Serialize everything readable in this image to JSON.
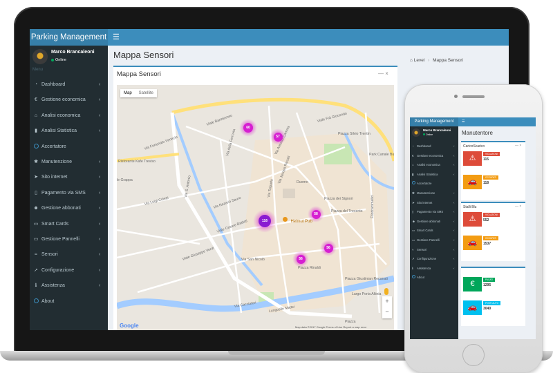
{
  "app": {
    "brand": "Parking Management"
  },
  "user": {
    "name": "Marco Brancaleoni",
    "status": "Online"
  },
  "sidebar": {
    "header": "Menu",
    "items": [
      {
        "label": "Dashboard",
        "icon": "dashboard-icon",
        "glyph": "◔",
        "chevron": "‹"
      },
      {
        "label": "Gestione economica",
        "icon": "euro-icon",
        "glyph": "€",
        "chevron": "‹"
      },
      {
        "label": "Analisi economica",
        "icon": "bank-icon",
        "glyph": "⌂",
        "chevron": "‹"
      },
      {
        "label": "Analisi Statistica",
        "icon": "bar-chart-icon",
        "glyph": "▮",
        "chevron": "‹"
      },
      {
        "label": "Accertatore",
        "icon": "circle-icon",
        "glyph": "",
        "chevron": ""
      },
      {
        "label": "Manutenzione",
        "icon": "gear-icon",
        "glyph": "✱",
        "chevron": "‹"
      },
      {
        "label": "Sito internet",
        "icon": "arrow-icon",
        "glyph": "➤",
        "chevron": "‹"
      },
      {
        "label": "Pagamento via SMS",
        "icon": "phone-icon",
        "glyph": "▯",
        "chevron": "‹"
      },
      {
        "label": "Gestione abbonati",
        "icon": "users-icon",
        "glyph": "☻",
        "chevron": "‹"
      },
      {
        "label": "Smart Cards",
        "icon": "credit-card-icon",
        "glyph": "▭",
        "chevron": "‹"
      },
      {
        "label": "Gestione Pannelli",
        "icon": "monitor-icon",
        "glyph": "▭",
        "chevron": "‹"
      },
      {
        "label": "Sensori",
        "icon": "wifi-icon",
        "glyph": "≈",
        "chevron": "‹"
      },
      {
        "label": "Configurazione",
        "icon": "rocket-icon",
        "glyph": "➚",
        "chevron": "‹"
      },
      {
        "label": "Assistenza",
        "icon": "info-icon",
        "glyph": "ℹ",
        "chevron": "‹"
      },
      {
        "label": "About",
        "icon": "circle-icon",
        "glyph": "",
        "chevron": ""
      }
    ]
  },
  "content": {
    "title": "Mappa Sensori",
    "breadcrumb": {
      "home": "Level",
      "current": "Mappa Sensori"
    }
  },
  "map_box": {
    "title": "Mappa Sensori",
    "tools": "—   ×",
    "map_type": [
      "Map",
      "Satellite"
    ],
    "zoom_in": "+",
    "zoom_out": "−",
    "logo": "Google",
    "copyright": "Map data ©2017 Google   Terms of Use   Report a map error",
    "pois": [
      "Helmut Pub"
    ],
    "streets": [
      "Viale Bartolomeo",
      "Via Fortunato Venezio",
      "Viale Frà Giocondo",
      "Piazza Silvio Trentin",
      "Park Canale Buranelli",
      "Via Antonio Canova",
      "Via Jacopo Riccati",
      "Duomo",
      "Piazza dei Signori",
      "Piazza del Trecento",
      "Via Luigi Coletti",
      "Viale Giuseppe Verdi",
      "Via San Nicolò",
      "Piazza Rinaldi",
      "Piazza Giustinian Recanati",
      "Via Cacciatori",
      "Via della Ferrovia",
      "Filodrammatici",
      "Piazza",
      "Largo Porta Altinia",
      "Lungosile Mattei",
      "Via Nazario Sauro",
      "Viale Cesare Battisti",
      "Ristorante Kafe Treviso",
      "le Grappa",
      "Via S. Antonio",
      "Via Tolpada"
    ],
    "clusters": [
      "60",
      "57",
      "116",
      "58",
      "56",
      "56"
    ]
  },
  "mobile": {
    "brand": "Parking Management",
    "user": {
      "name": "Marco Brancaleoni",
      "status": "Online"
    },
    "sidebar_items": [
      {
        "label": "Dashboard",
        "glyph": "◔",
        "chevron": "‹"
      },
      {
        "label": "Gestione economica",
        "glyph": "€",
        "chevron": "‹"
      },
      {
        "label": "Analisi economica",
        "glyph": "⌂",
        "chevron": "‹"
      },
      {
        "label": "Analisi Statistica",
        "glyph": "▮",
        "chevron": "‹"
      },
      {
        "label": "Accertatore",
        "glyph": "",
        "chevron": ""
      },
      {
        "label": "Manutenzione",
        "glyph": "✱",
        "chevron": "‹"
      },
      {
        "label": "Sito internet",
        "glyph": "➤",
        "chevron": "‹"
      },
      {
        "label": "Pagamento via SMS",
        "glyph": "▯",
        "chevron": "‹"
      },
      {
        "label": "Gestione abbonati",
        "glyph": "☻",
        "chevron": "‹"
      },
      {
        "label": "Smart Cards",
        "glyph": "▭",
        "chevron": "‹"
      },
      {
        "label": "Gestione Pannelli",
        "glyph": "▭",
        "chevron": "‹"
      },
      {
        "label": "Sensori",
        "glyph": "≈",
        "chevron": "‹"
      },
      {
        "label": "Configurazione",
        "glyph": "➚",
        "chevron": "‹"
      },
      {
        "label": "Assistenza",
        "glyph": "ℹ",
        "chevron": "‹"
      },
      {
        "label": "About",
        "glyph": "",
        "chevron": ""
      }
    ],
    "page_title": "Manutentore",
    "cards": [
      {
        "title": "CaricoScarico",
        "tools": "— ×",
        "rows": [
          {
            "icon": "warning-icon",
            "glyph": "⚠",
            "tag": "VIOLAZIONI",
            "value": "115"
          },
          {
            "icon": "car-icon",
            "glyph": "🚗",
            "tag": "OCCUPATI",
            "value": "118"
          }
        ]
      },
      {
        "title": "Stalli Blu",
        "tools": "— ×",
        "rows": [
          {
            "icon": "warning-icon",
            "glyph": "⚠",
            "tag": "VIOLAZIONI",
            "value": "552"
          },
          {
            "icon": "car-icon",
            "glyph": "🚗",
            "tag": "OCCUPATI",
            "value": "1537"
          }
        ]
      },
      {
        "title": "",
        "tools": "",
        "rows": [
          {
            "icon": "euro-icon",
            "glyph": "€",
            "tag": "PAGATI",
            "value": "1295"
          },
          {
            "icon": "car-icon",
            "glyph": "🚗",
            "tag": "POSTI AUTO",
            "value": "3040"
          }
        ]
      }
    ]
  },
  "colors": {
    "primary": "#3c8dbc",
    "brand_dark": "#367fa9",
    "sidebar": "#222d32",
    "sidebar_text": "#b8c7ce",
    "cluster": "#d61fd1",
    "danger": "#dd4b39",
    "warning": "#f39c12",
    "success": "#00a65a",
    "info": "#00c0ef"
  }
}
